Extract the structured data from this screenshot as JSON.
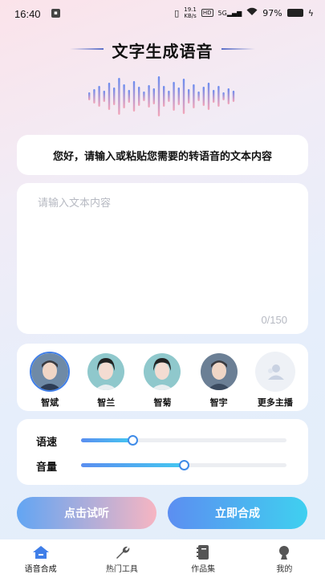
{
  "status_bar": {
    "time": "16:40",
    "speed_top": "19.1",
    "speed_bottom": "KB/s",
    "hd": "HD",
    "network": "5G",
    "battery": "97%"
  },
  "header": {
    "title": "文字生成语音"
  },
  "prompt": {
    "text": "您好，请输入或粘贴您需要的转语音的文本内容"
  },
  "editor": {
    "placeholder": "请输入文本内容",
    "counter": "0/150"
  },
  "voices": [
    {
      "name": "智斌",
      "selected": true
    },
    {
      "name": "智兰",
      "selected": false
    },
    {
      "name": "智菊",
      "selected": false
    },
    {
      "name": "智宇",
      "selected": false
    },
    {
      "name": "更多主播",
      "selected": false
    }
  ],
  "sliders": {
    "speed": {
      "label": "语速",
      "value_fraction": 0.25
    },
    "volume": {
      "label": "音量",
      "value_fraction": 0.5
    }
  },
  "actions": {
    "listen": "点击试听",
    "synthesize": "立即合成"
  },
  "tabs": [
    {
      "label": "语音合成",
      "icon": "home-icon",
      "active": true
    },
    {
      "label": "热门工具",
      "icon": "wrench-icon",
      "active": false
    },
    {
      "label": "作品集",
      "icon": "notebook-icon",
      "active": false
    },
    {
      "label": "我的",
      "icon": "profile-icon",
      "active": false
    }
  ],
  "colors": {
    "accent": "#3f8be8",
    "active_tab": "#3f7ee8"
  }
}
